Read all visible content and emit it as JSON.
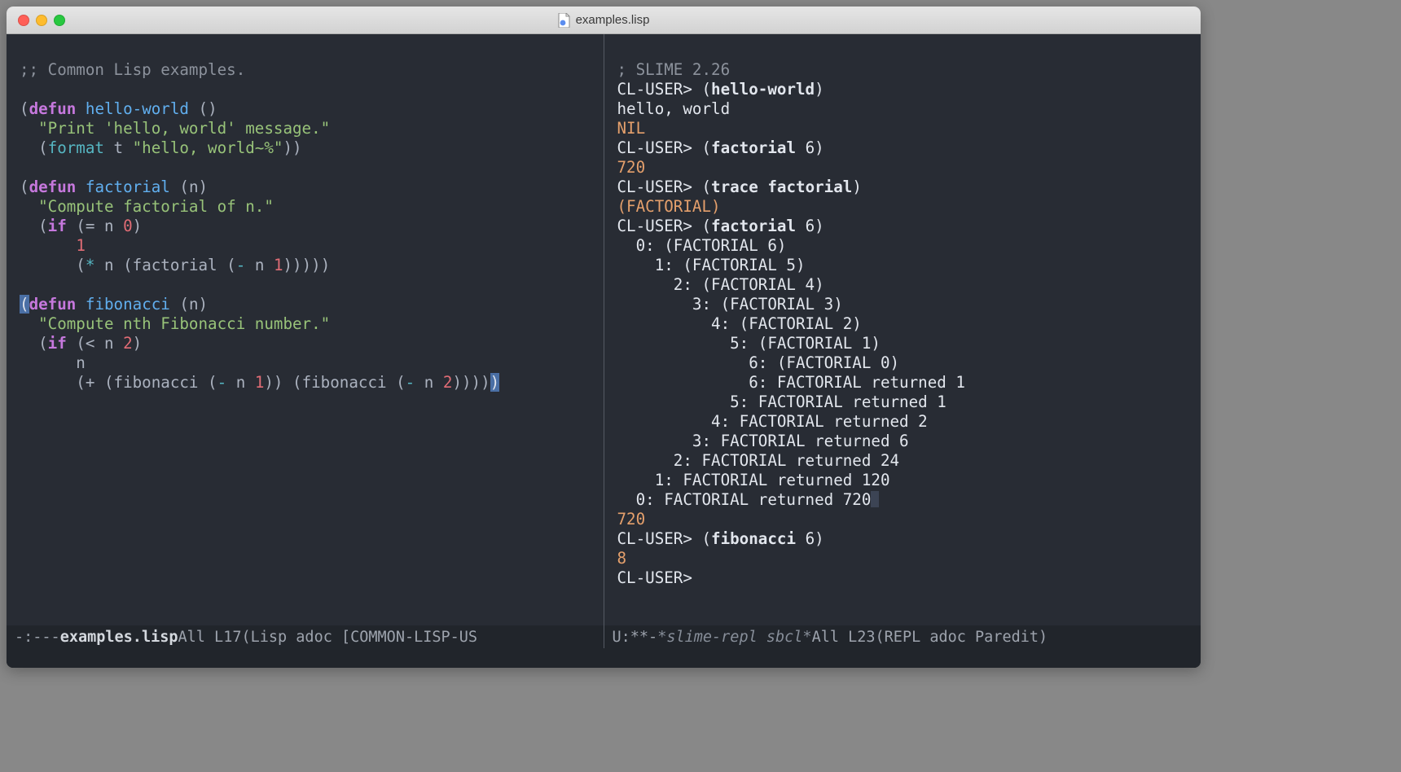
{
  "window": {
    "title": "examples.lisp"
  },
  "left": {
    "l01_comment": ";; Common Lisp examples.",
    "l02_p": "(",
    "l02_defun": "defun",
    "l02_sp": " ",
    "l02_name": "hello-world",
    "l02_args": " ()",
    "l03_doc": "  \"Print 'hello, world' message.\"",
    "l04_a": "  (",
    "l04_fmt": "format",
    "l04_b": " t ",
    "l04_s": "\"hello, world~%\"",
    "l04_c": "))",
    "l05_p": "(",
    "l05_defun": "defun",
    "l05_sp": " ",
    "l05_name": "factorial",
    "l05_args": " (n)",
    "l06_doc": "  \"Compute factorial of n.\"",
    "l07_a": "  (",
    "l07_if": "if",
    "l07_b": " (= n ",
    "l07_0": "0",
    "l07_c": ")",
    "l08_a": "      ",
    "l08_1": "1",
    "l09_a": "      (",
    "l09_star": "*",
    "l09_b": " n (factorial (",
    "l09_minus": "-",
    "l09_c": " n ",
    "l09_1": "1",
    "l09_d": ")))))",
    "l10_p": "(",
    "l10_defun": "defun",
    "l10_sp": " ",
    "l10_name": "fibonacci",
    "l10_args": " (n)",
    "l11_doc": "  \"Compute nth Fibonacci number.\"",
    "l12_a": "  (",
    "l12_if": "if",
    "l12_b": " (< n ",
    "l12_2": "2",
    "l12_c": ")",
    "l13": "      n",
    "l14_a": "      (+ (fibonacci (",
    "l14_m1": "-",
    "l14_b": " n ",
    "l14_1": "1",
    "l14_c": ")) (fibonacci (",
    "l14_m2": "-",
    "l14_d": " n ",
    "l14_2": "2",
    "l14_e": "))))",
    "l14_f": ")"
  },
  "right": {
    "r01": "; SLIME 2.26",
    "r02_p": "CL-USER> ",
    "r02_a": "(",
    "r02_fn": "hello-world",
    "r02_b": ")",
    "r03": "hello, world",
    "r04": "NIL",
    "r05_p": "CL-USER> ",
    "r05_a": "(",
    "r05_fn": "factorial",
    "r05_b": " ",
    "r05_n": "6",
    "r05_c": ")",
    "r06": "720",
    "r07_p": "CL-USER> ",
    "r07_a": "(",
    "r07_fn": "trace",
    "r07_b": " ",
    "r07_arg": "factorial",
    "r07_c": ")",
    "r08": "(FACTORIAL)",
    "r09_p": "CL-USER> ",
    "r09_a": "(",
    "r09_fn": "factorial",
    "r09_b": " ",
    "r09_n": "6",
    "r09_c": ")",
    "t0": "  0: (FACTORIAL 6)",
    "t1": "    1: (FACTORIAL 5)",
    "t2": "      2: (FACTORIAL 4)",
    "t3": "        3: (FACTORIAL 3)",
    "t4": "          4: (FACTORIAL 2)",
    "t5": "            5: (FACTORIAL 1)",
    "t6": "              6: (FACTORIAL 0)",
    "r6": "              6: FACTORIAL returned 1",
    "r5": "            5: FACTORIAL returned 1",
    "r4": "          4: FACTORIAL returned 2",
    "r3": "        3: FACTORIAL returned 6",
    "r2": "      2: FACTORIAL returned 24",
    "r1": "    1: FACTORIAL returned 120",
    "r0a": "  0: FACTORIAL returned 720",
    "r20": "720",
    "r21_p": "CL-USER> ",
    "r21_a": "(",
    "r21_fn": "fibonacci",
    "r21_b": " ",
    "r21_n": "6",
    "r21_c": ")",
    "r22": "8",
    "r23_p": "CL-USER> "
  },
  "modeline": {
    "left_prefix": "-:---  ",
    "left_buf": "examples.lisp",
    "left_pos": "   All L17    ",
    "left_mode": "(Lisp adoc [COMMON-LISP-US",
    "right_prefix": "U:**-  ",
    "right_buf": "*slime-repl sbcl*",
    "right_pos": "   All L23    ",
    "right_mode": "(REPL adoc Paredit)"
  }
}
